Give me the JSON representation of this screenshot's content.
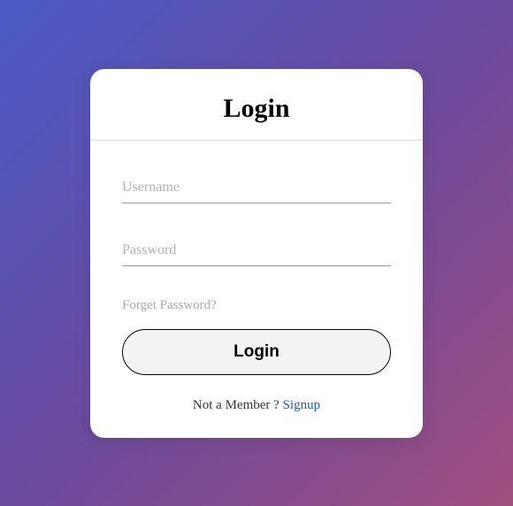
{
  "card": {
    "title": "Login",
    "username_placeholder": "Username",
    "password_placeholder": "Password",
    "forgot_text": "Forget Password?",
    "login_button": "Login",
    "footer_text": "Not a Member ? ",
    "signup_text": "Signup"
  }
}
